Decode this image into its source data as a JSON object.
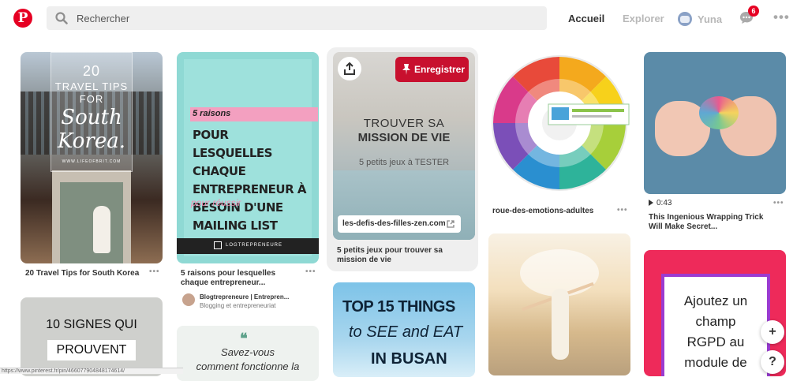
{
  "header": {
    "search_placeholder": "Rechercher",
    "nav_home": "Accueil",
    "nav_explore": "Explorer",
    "user_name": "Yuna",
    "notifications_count": "6",
    "more_label": "•••"
  },
  "pins": [
    {
      "caption": "20 Travel Tips for South Korea",
      "image_text": {
        "line1": "20",
        "line2": "TRAVEL TIPS",
        "line3": "FOR",
        "line4": "South",
        "line5": "Korea.",
        "line6": "WWW.LIFEOFBRIT.COM"
      }
    },
    {
      "caption_line1": "5 raisons pour lesquelles",
      "caption_line2": "chaque entrepreneur...",
      "author_name": "Blogtrepreneure | Entrepren...",
      "author_sub": "Blogging et entrepreneuriat",
      "image_text": {
        "line1": "5 raisons",
        "line2": "POUR LESQUELLES CHAQUE ENTREPRENEUR À BESOIN D'UNE MAILING LIST",
        "line3": "pour réussir",
        "brand": "LOGTREPRENEURE"
      }
    },
    {
      "caption_line1": "5 petits jeux pour trouver sa",
      "caption_line2": "mission de vie",
      "save_label": "Enregistrer",
      "url_label": "les-defis-des-filles-zen.com",
      "image_text": {
        "line1": "TROUVER SA",
        "line2": "MISSION DE VIE",
        "line3": "5 petits jeux à TESTER"
      }
    },
    {
      "caption": "roue-des-emotions-adultes"
    },
    {
      "duration": "0:43",
      "caption_line1": "This Ingenious Wrapping Trick",
      "caption_line2": "Will Make Secret..."
    },
    {
      "image_text": {
        "line1": "10 SIGNES QUI",
        "line2": "PROUVENT"
      }
    },
    {
      "image_text": {
        "quote": "❝",
        "line1": "Savez-vous",
        "line2": "comment fonctionne la"
      }
    },
    {
      "image_text": {
        "line1": "TOP 15 THINGS",
        "line2": "to SEE and EAT",
        "line3": "IN BUSAN"
      }
    },
    {},
    {
      "image_text": {
        "line1": "Ajoutez un",
        "line2": "champ",
        "line3": "RGPD au",
        "line4": "module de"
      }
    }
  ],
  "fab": {
    "add": "+",
    "help": "?"
  },
  "status_bar": "https://www.pinterest.fr/pin/466077904848174614/",
  "colors": {
    "brand_red": "#e60023",
    "save_button": "#c8102e"
  }
}
